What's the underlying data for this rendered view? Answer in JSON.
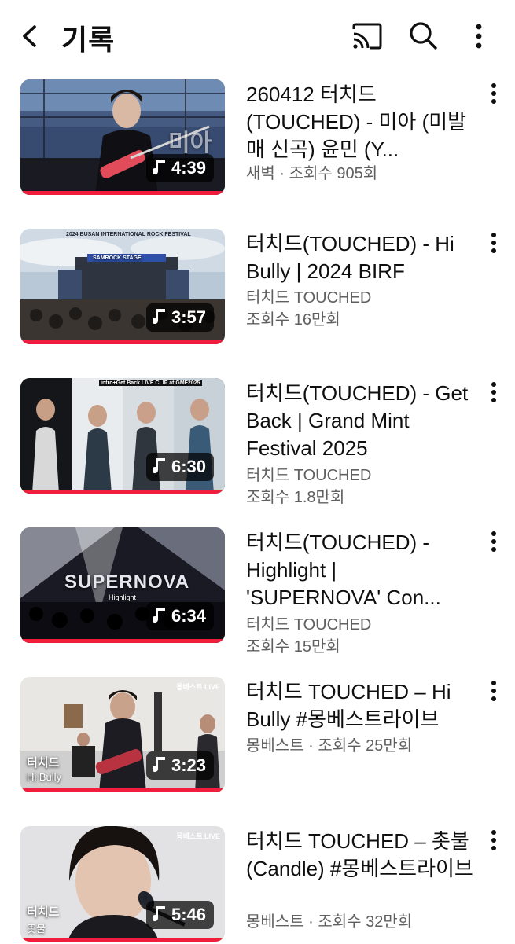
{
  "header": {
    "title": "기록",
    "icons": [
      "back-icon",
      "cast-icon",
      "search-icon",
      "more-vert-icon"
    ]
  },
  "videos": [
    {
      "title": "260412 터치드 (TOUCHED) - 미아 (미발매 신곡)  윤민 (Y...",
      "channel": "새벽",
      "views": "조회수 905회",
      "meta_line1": "새벽 · 조회수 905회",
      "meta_line2": "",
      "duration": "4:39",
      "overlay": "미아",
      "watched_fraction": 1.0
    },
    {
      "title": "터치드(TOUCHED) - Hi Bully | 2024 BIRF",
      "meta_line1": "터치드 TOUCHED",
      "meta_line2": "조회수 16만회",
      "duration": "3:57",
      "overlay": "2024 BUSAN INTERNATIONAL ROCK FESTIVAL",
      "overlay2": "SAMROCK STAGE",
      "watched_fraction": 1.0
    },
    {
      "title": "터치드(TOUCHED) - Get Back | Grand Mint Festival 2025",
      "meta_line1": "터치드 TOUCHED",
      "meta_line2": "조회수 1.8만회",
      "duration": "6:30",
      "overlay": "intro+Get Back LIVE CLIP at GMF2025",
      "watched_fraction": 1.0
    },
    {
      "title": "터치드(TOUCHED) - Highlight | 'SUPERNOVA' Con...",
      "meta_line1": "터치드 TOUCHED",
      "meta_line2": "조회수 15만회",
      "duration": "6:34",
      "overlay": "SUPERNOVA",
      "overlay2": "Highlight",
      "watched_fraction": 1.0
    },
    {
      "title": "터치드 TOUCHED – Hi Bully #몽베스트라이브",
      "meta_line1": "몽베스트 · 조회수 25만회",
      "meta_line2": "",
      "duration": "3:23",
      "overlay": "터치드",
      "overlay2": "Hi Bully",
      "badge": "몽베스트 LIVE",
      "watched_fraction": 1.0
    },
    {
      "title": "터치드 TOUCHED – 촛불 (Candle) #몽베스트라이브",
      "meta_line1": "몽베스트 · 조회수 32만회",
      "meta_line2": "",
      "duration": "5:46",
      "overlay": "터치드",
      "overlay2": "촛불",
      "badge": "몽베스트 LIVE",
      "watched_fraction": 1.0
    }
  ]
}
